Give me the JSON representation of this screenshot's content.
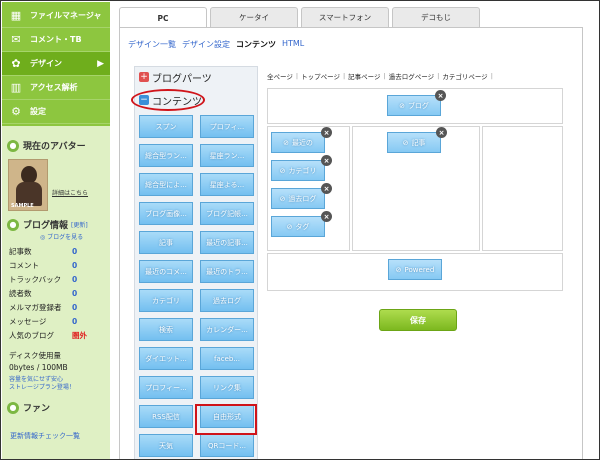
{
  "sidebar": {
    "nav": [
      {
        "label": "ファイルマネージャ",
        "icon": "folder-icon",
        "glyph": "▦"
      },
      {
        "label": "コメント・TB",
        "icon": "comment-icon",
        "glyph": "✉"
      },
      {
        "label": "デザイン",
        "icon": "palette-icon",
        "glyph": "✿"
      },
      {
        "label": "アクセス解析",
        "icon": "chart-icon",
        "glyph": "▥"
      },
      {
        "label": "設定",
        "icon": "gear-icon",
        "glyph": "⚙"
      }
    ],
    "avatar_title": "現在のアバター",
    "avatar_sample": "SAMPLE",
    "avatar_link": "詳細はこちら",
    "blog_info_title": "ブログ情報",
    "blog_info_update": "[更新]",
    "view_blog": "ブログを見る",
    "stats": [
      {
        "label": "記事数",
        "value": "0"
      },
      {
        "label": "コメント",
        "value": "0"
      },
      {
        "label": "トラックバック",
        "value": "0"
      },
      {
        "label": "読者数",
        "value": "0"
      },
      {
        "label": "メルマガ登録者",
        "value": "0"
      },
      {
        "label": "メッセージ",
        "value": "0"
      },
      {
        "label": "人気のブログ",
        "value": "圏外"
      }
    ],
    "disk_title": "ディスク使用量",
    "disk_usage": "0bytes / 100MB",
    "disk_note_1": "容量を気にせず安心",
    "disk_note_2": "ストレージプラン登場！",
    "fan_title": "ファン",
    "update_check": "更新情報チェック一覧"
  },
  "tabs": [
    "PC",
    "ケータイ",
    "スマートフォン",
    "デコもじ"
  ],
  "active_tab": "PC",
  "subnav": [
    "デザイン一覧",
    "デザイン設定",
    "コンテンツ",
    "HTML"
  ],
  "parts": {
    "blog_parts": "ブログパーツ",
    "contents": "コンテンツ",
    "items": [
      "スプン",
      "プロフィ...",
      "総合型ラン...",
      "星座ラン...",
      "総合型によ...",
      "星座よる...",
      "ブログ画像...",
      "ブログ記帳...",
      "記事",
      "最近の記事...",
      "最近のコメ...",
      "最近のトラ...",
      "カテゴリ",
      "過去ログ",
      "検索",
      "カレンダー...",
      "ダイエット...",
      "faceb...",
      "プロフィー...",
      "リンク集",
      "RSS配信",
      "自由形式",
      "天気",
      "QRコード..."
    ]
  },
  "layout": {
    "tabs": [
      "全ページ",
      "トップページ",
      "記事ページ",
      "過去ログページ",
      "カテゴリページ"
    ],
    "top_part": "ブログ",
    "left_parts": [
      "最近の",
      "カテゴリ",
      "過去ログ",
      "タグ"
    ],
    "center_part": "記事",
    "footer_part": "Powered"
  },
  "save_label": "保存",
  "colors": {
    "accent": "#8dc63f",
    "part_blue": "#73bff0",
    "highlight_red": "#d0141a"
  }
}
